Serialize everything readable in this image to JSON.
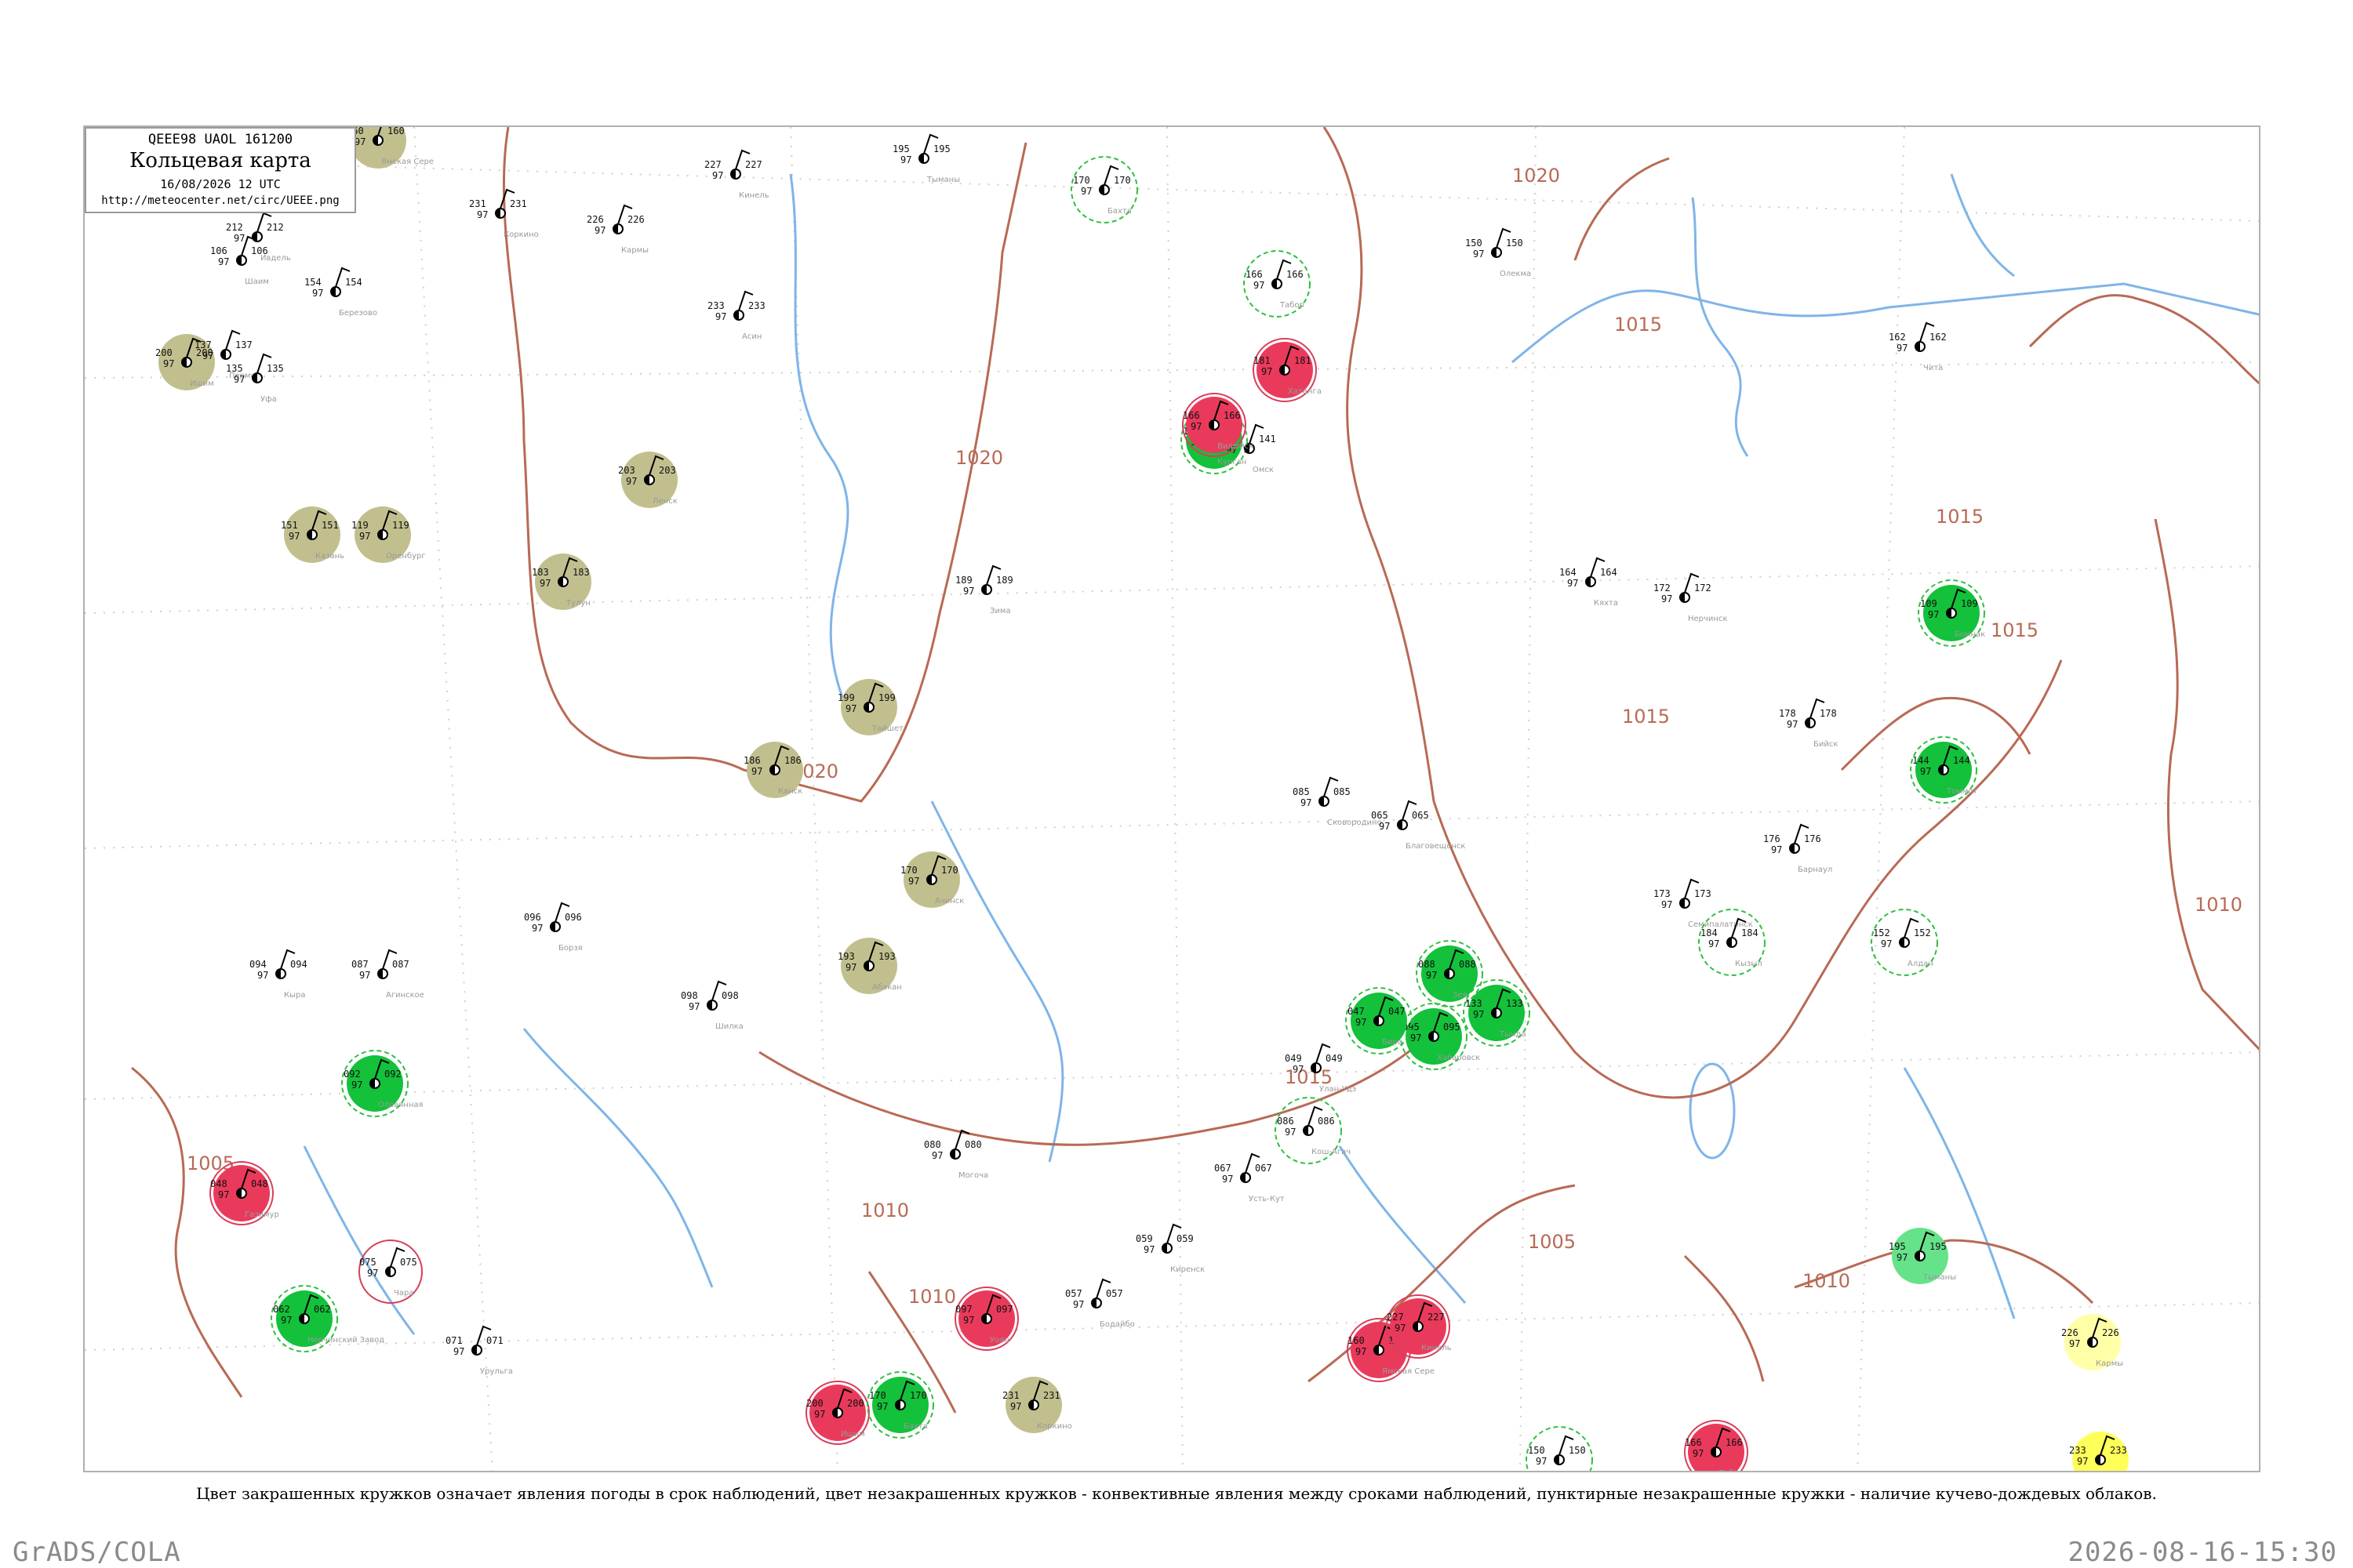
{
  "title_box": {
    "code": "QEEE98  UAOL  161200",
    "name": "Кольцевая карта",
    "time": "16/08/2026 12 UTC",
    "url": "http://meteocenter.net/circ/UEEE.png"
  },
  "caption": "Цвет закрашенных кружков означает явления погоды в срок наблюдений, цвет незакрашенных кружков - конвективные явления между сроками наблюдений, пунктирные незакрашенные кружки - наличие кучево-дождевых облаков.",
  "footer": {
    "left": "GrADS/COLA",
    "right": "2026-08-16-15:30"
  },
  "colors": {
    "olive": "#c2bf8f",
    "green": "#13c13b",
    "red": "#ea3a5c",
    "yellow": "#ffff5a",
    "light_yellow": "#ffffa8",
    "light_green": "#66e28a",
    "isobar": "#b86a55",
    "water": "#7fb5e8",
    "dashed_ring": "#2fbf3f",
    "red_ring": "#d83f5a"
  },
  "isobars": [
    "1020",
    "1015",
    "1020",
    "1020",
    "1015",
    "1015",
    "1015",
    "1010",
    "1005",
    "1005",
    "1010",
    "1010",
    "1015",
    "1010"
  ],
  "stations": [
    {
      "pressure": "160",
      "dew": "97",
      "name": "Ямская Сере"
    },
    {
      "pressure": "227",
      "dew": "97",
      "name": "Кинель"
    },
    {
      "pressure": "231",
      "dew": "97",
      "name": "Коркино"
    },
    {
      "pressure": "226",
      "dew": "97",
      "name": "Кармы"
    },
    {
      "pressure": "233",
      "dew": "97",
      "name": "Асин"
    },
    {
      "pressure": "195",
      "dew": "97",
      "name": "Тыманы"
    },
    {
      "pressure": "200",
      "dew": "97",
      "name": "Ишим"
    },
    {
      "pressure": "170",
      "dew": "97",
      "name": "Бахта"
    },
    {
      "pressure": "150",
      "dew": "97",
      "name": "Олекма"
    },
    {
      "pressure": "166",
      "dew": "97",
      "name": "Табор"
    },
    {
      "pressure": "212",
      "dew": "97",
      "name": "Ивдель"
    },
    {
      "pressure": "106",
      "dew": "97",
      "name": "Шаим"
    },
    {
      "pressure": "154",
      "dew": "97",
      "name": "Березово"
    },
    {
      "pressure": "137",
      "dew": "97",
      "name": "Пермь"
    },
    {
      "pressure": "135",
      "dew": "97",
      "name": "Уфа"
    },
    {
      "pressure": "114",
      "dew": "97",
      "name": "Курган"
    },
    {
      "pressure": "141",
      "dew": "97",
      "name": "Омск"
    },
    {
      "pressure": "203",
      "dew": "97",
      "name": "Ленск"
    },
    {
      "pressure": "183",
      "dew": "97",
      "name": "Тулун"
    },
    {
      "pressure": "151",
      "dew": "97",
      "name": "Казань"
    },
    {
      "pressure": "119",
      "dew": "97",
      "name": "Оренбург"
    },
    {
      "pressure": "162",
      "dew": "97",
      "name": "Чита"
    },
    {
      "pressure": "164",
      "dew": "97",
      "name": "Кяхта"
    },
    {
      "pressure": "172",
      "dew": "97",
      "name": "Нерчинск"
    },
    {
      "pressure": "181",
      "dew": "97",
      "name": "Хатанга"
    },
    {
      "pressure": "166",
      "dew": "97",
      "name": "Вилюйск"
    },
    {
      "pressure": "189",
      "dew": "97",
      "name": "Зима"
    },
    {
      "pressure": "199",
      "dew": "97",
      "name": "Тайшет"
    },
    {
      "pressure": "186",
      "dew": "97",
      "name": "Канск"
    },
    {
      "pressure": "170",
      "dew": "97",
      "name": "Ачинск"
    },
    {
      "pressure": "193",
      "dew": "97",
      "name": "Абакан"
    },
    {
      "pressure": "178",
      "dew": "97",
      "name": "Бийск"
    },
    {
      "pressure": "152",
      "dew": "97",
      "name": "Алдан"
    },
    {
      "pressure": "144",
      "dew": "97",
      "name": "Томмот"
    },
    {
      "pressure": "109",
      "dew": "97",
      "name": "Бомнак"
    },
    {
      "pressure": "176",
      "dew": "97",
      "name": "Барнаул"
    },
    {
      "pressure": "173",
      "dew": "97",
      "name": "Семипалатинск"
    },
    {
      "pressure": "184",
      "dew": "97",
      "name": "Кызыл"
    },
    {
      "pressure": "088",
      "dew": "97",
      "name": "Зея"
    },
    {
      "pressure": "133",
      "dew": "97",
      "name": "Тында"
    },
    {
      "pressure": "085",
      "dew": "97",
      "name": "Сковородино"
    },
    {
      "pressure": "065",
      "dew": "97",
      "name": "Благовещенск"
    },
    {
      "pressure": "095",
      "dew": "97",
      "name": "Хабаровск"
    },
    {
      "pressure": "047",
      "dew": "97",
      "name": "Бира"
    },
    {
      "pressure": "049",
      "dew": "97",
      "name": "Улан-Удэ"
    },
    {
      "pressure": "086",
      "dew": "97",
      "name": "Кош-Агач"
    },
    {
      "pressure": "067",
      "dew": "97",
      "name": "Усть-Кут"
    },
    {
      "pressure": "059",
      "dew": "97",
      "name": "Киренск"
    },
    {
      "pressure": "057",
      "dew": "97",
      "name": "Бодайбо"
    },
    {
      "pressure": "080",
      "dew": "97",
      "name": "Могоча"
    },
    {
      "pressure": "098",
      "dew": "97",
      "name": "Шилка"
    },
    {
      "pressure": "096",
      "dew": "97",
      "name": "Борзя"
    },
    {
      "pressure": "094",
      "dew": "97",
      "name": "Кыра"
    },
    {
      "pressure": "087",
      "dew": "97",
      "name": "Агинское"
    },
    {
      "pressure": "092",
      "dew": "97",
      "name": "Оловянная"
    },
    {
      "pressure": "048",
      "dew": "97",
      "name": "Газимур"
    },
    {
      "pressure": "062",
      "dew": "97",
      "name": "Нерчинский Завод"
    },
    {
      "pressure": "071",
      "dew": "97",
      "name": "Урульга"
    },
    {
      "pressure": "075",
      "dew": "97",
      "name": "Чара"
    },
    {
      "pressure": "097",
      "dew": "97",
      "name": "Уоян"
    }
  ]
}
